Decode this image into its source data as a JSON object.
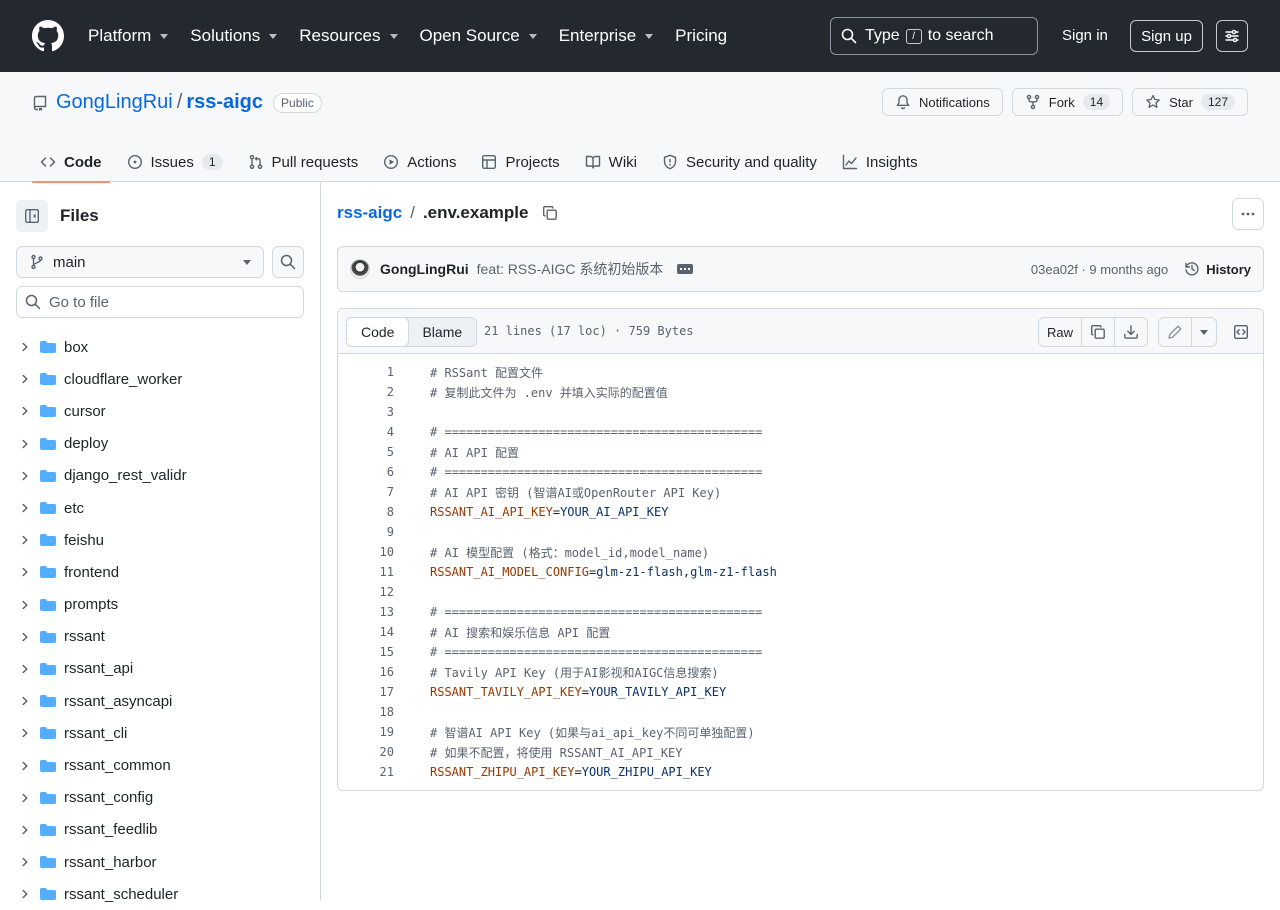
{
  "header": {
    "nav": [
      "Platform",
      "Solutions",
      "Resources",
      "Open Source",
      "Enterprise",
      "Pricing"
    ],
    "nav_has_caret": [
      true,
      true,
      true,
      true,
      true,
      false
    ],
    "search_prefix": "Type",
    "search_key": "/",
    "search_suffix": "to search",
    "sign_in": "Sign in",
    "sign_up": "Sign up"
  },
  "repo": {
    "owner": "GongLingRui",
    "separator": "/",
    "name": "rss-aigc",
    "visibility": "Public",
    "notifications_label": "Notifications",
    "fork_label": "Fork",
    "fork_count": "14",
    "star_label": "Star",
    "star_count": "127"
  },
  "tabs": [
    {
      "label": "Code",
      "icon": "code-icon",
      "count": null,
      "selected": true
    },
    {
      "label": "Issues",
      "icon": "issue-icon",
      "count": "1",
      "selected": false
    },
    {
      "label": "Pull requests",
      "icon": "pull-request-icon",
      "count": null,
      "selected": false
    },
    {
      "label": "Actions",
      "icon": "play-icon",
      "count": null,
      "selected": false
    },
    {
      "label": "Projects",
      "icon": "table-icon",
      "count": null,
      "selected": false
    },
    {
      "label": "Wiki",
      "icon": "book-icon",
      "count": null,
      "selected": false
    },
    {
      "label": "Security and quality",
      "icon": "shield-icon",
      "count": null,
      "selected": false
    },
    {
      "label": "Insights",
      "icon": "graph-icon",
      "count": null,
      "selected": false
    }
  ],
  "sidebar": {
    "title": "Files",
    "branch": "main",
    "goto_placeholder": "Go to file",
    "tree": [
      "box",
      "cloudflare_worker",
      "cursor",
      "deploy",
      "django_rest_validr",
      "etc",
      "feishu",
      "frontend",
      "prompts",
      "rssant",
      "rssant_api",
      "rssant_asyncapi",
      "rssant_cli",
      "rssant_common",
      "rssant_config",
      "rssant_feedlib",
      "rssant_harbor",
      "rssant_scheduler"
    ]
  },
  "file": {
    "repo_crumb": "rss-aigc",
    "crumb_sep": "/",
    "filename": ".env.example",
    "commit_author": "GongLingRui",
    "commit_message": "feat: RSS-AIGC 系统初始版本",
    "commit_meta": "03ea02f · 9 months ago",
    "history_label": "History",
    "view_code": "Code",
    "view_blame": "Blame",
    "info": "21 lines (17 loc) · 759 Bytes",
    "raw_label": "Raw"
  },
  "code_lines": [
    {
      "c": "# RSSant 配置文件"
    },
    {
      "c": "# 复制此文件为 .env 并填入实际的配置值"
    },
    {
      "c": ""
    },
    {
      "c": "# ============================================"
    },
    {
      "c": "# AI API 配置"
    },
    {
      "c": "# ============================================"
    },
    {
      "c": "# AI API 密钥 (智谱AI或OpenRouter API Key)"
    },
    {
      "k": "RSSANT_AI_API_KEY",
      "v": "YOUR_AI_API_KEY"
    },
    {
      "c": ""
    },
    {
      "c": "# AI 模型配置 (格式：model_id,model_name)"
    },
    {
      "k": "RSSANT_AI_MODEL_CONFIG",
      "v": "glm-z1-flash,glm-z1-flash"
    },
    {
      "c": ""
    },
    {
      "c": "# ============================================"
    },
    {
      "c": "# AI 搜索和娱乐信息 API 配置"
    },
    {
      "c": "# ============================================"
    },
    {
      "c": "# Tavily API Key (用于AI影视和AIGC信息搜索)"
    },
    {
      "k": "RSSANT_TAVILY_API_KEY",
      "v": "YOUR_TAVILY_API_KEY"
    },
    {
      "c": ""
    },
    {
      "c": "# 智谱AI API Key (如果与ai_api_key不同可单独配置)"
    },
    {
      "c": "# 如果不配置，将使用 RSSANT_AI_API_KEY"
    },
    {
      "k": "RSSANT_ZHIPU_API_KEY",
      "v": "YOUR_ZHIPU_API_KEY"
    }
  ],
  "colors": {
    "header_bg": "#24292f",
    "link": "#0969da",
    "tab_underline": "#fd8c73",
    "folder": "#54aeff",
    "code_key": "#953800",
    "code_value": "#0a3069"
  }
}
